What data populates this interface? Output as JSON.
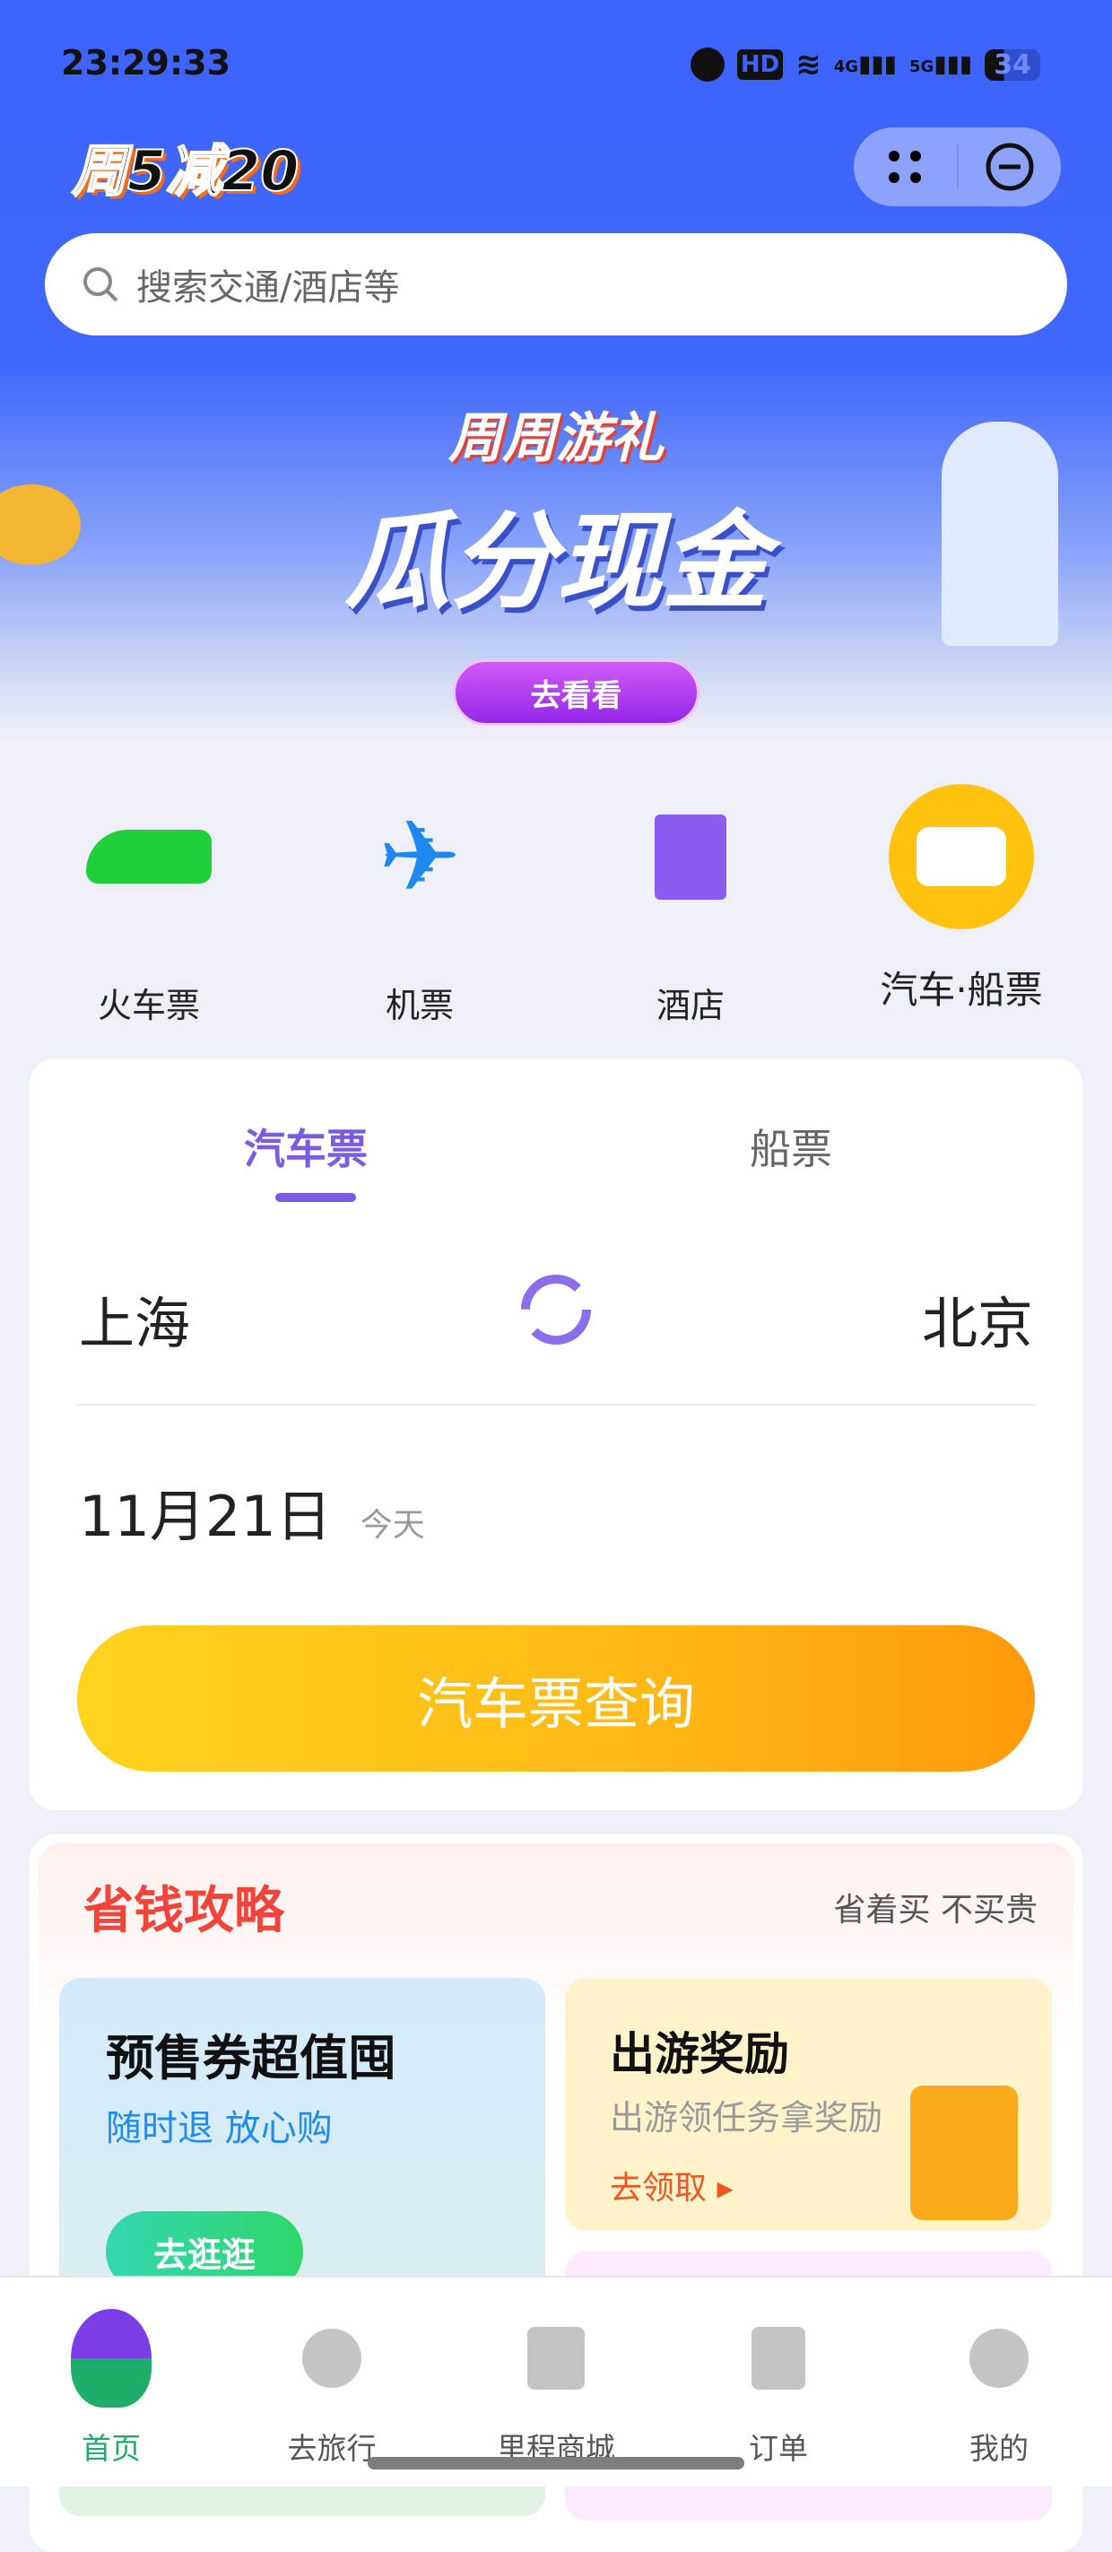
{
  "status_bar": {
    "time": "23:29:33",
    "battery": "34",
    "network": [
      "4G",
      "5G"
    ],
    "icons": [
      "alarm-icon",
      "hd-icon",
      "wifi-icon",
      "signal-icon",
      "signal-icon",
      "battery-icon"
    ]
  },
  "header": {
    "logo_text": "周5减20",
    "search_placeholder": "搜索交通/酒店等",
    "capsule_icons": [
      "more-dots-icon",
      "close-circle-icon"
    ]
  },
  "banner": {
    "subtitle": "周周游礼",
    "title": "瓜分现金",
    "button": "去看看"
  },
  "categories": [
    {
      "label": "火车票",
      "icon": "train-icon"
    },
    {
      "label": "机票",
      "icon": "plane-icon"
    },
    {
      "label": "酒店",
      "icon": "hotel-icon"
    },
    {
      "label": "汽车·船票",
      "icon": "bus-icon",
      "active": true
    }
  ],
  "booking": {
    "tabs": [
      {
        "label": "汽车票",
        "active": true
      },
      {
        "label": "船票",
        "active": false
      }
    ],
    "from": "上海",
    "to": "北京",
    "date": "11月21日",
    "date_note": "今天",
    "search_button": "汽车票查询"
  },
  "savings": {
    "title": "省钱攻略",
    "tagline": "省着买 不买贵",
    "cards": [
      {
        "title": "预售券超值囤",
        "subtitle": "随时退 放心购",
        "button": "去逛逛"
      },
      {
        "title": "出游奖励",
        "subtitle": "出游领任务拿奖励",
        "link": "去领取"
      }
    ]
  },
  "bottom_nav": [
    {
      "label": "首页",
      "active": true
    },
    {
      "label": "去旅行"
    },
    {
      "label": "里程商城"
    },
    {
      "label": "订单"
    },
    {
      "label": "我的"
    }
  ],
  "colors": {
    "brand_blue": "#3d63fb",
    "accent_purple": "#7b5ce0",
    "nav_active": "#1fae6a",
    "button_yellow": "#ffb814"
  }
}
